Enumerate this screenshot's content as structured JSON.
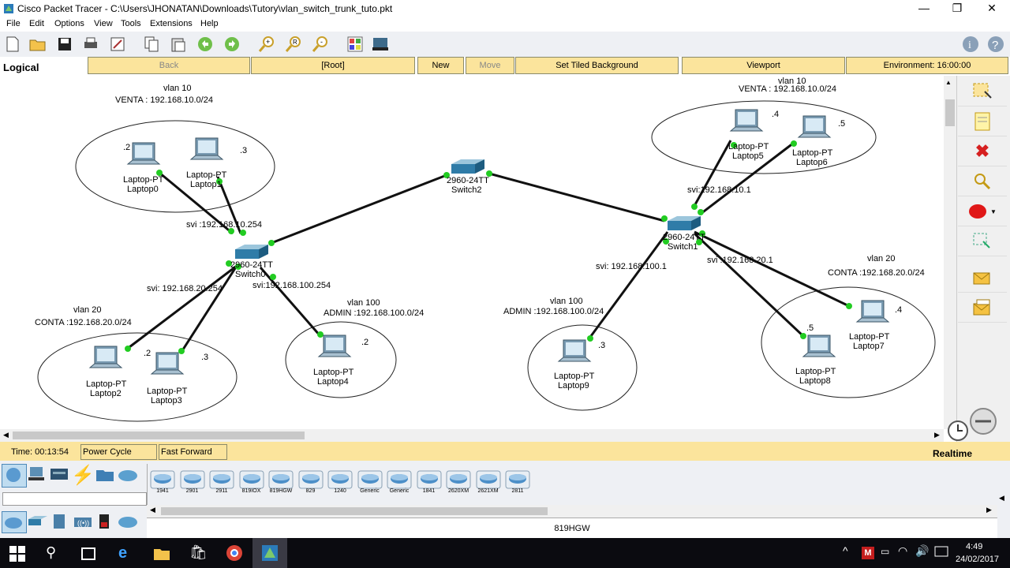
{
  "window": {
    "title": "Cisco Packet Tracer - C:\\Users\\JHONATAN\\Downloads\\Tutory\\vlan_switch_trunk_tuto.pkt"
  },
  "menu": [
    "File",
    "Edit",
    "Options",
    "View",
    "Tools",
    "Extensions",
    "Help"
  ],
  "nav": {
    "mode": "Logical",
    "back": "Back",
    "root": "[Root]",
    "new_cluster": "New Cluster",
    "move_object": "Move Object",
    "tiled_bg": "Set Tiled Background",
    "viewport": "Viewport",
    "environment": "Environment: 16:00:00"
  },
  "topology": {
    "switch0": {
      "model": "2960-24TT",
      "name": "Switch0"
    },
    "switch1": {
      "model": "2960-24TT",
      "name": "Switch1"
    },
    "switch2": {
      "model": "2960-24TT",
      "name": "Switch2"
    },
    "devices": {
      "laptop0": {
        "model": "Laptop-PT",
        "name": "Laptop0",
        "ip": ".2"
      },
      "laptop1": {
        "model": "Laptop-PT",
        "name": "Laptop1",
        "ip": ".3"
      },
      "laptop2": {
        "model": "Laptop-PT",
        "name": "Laptop2",
        "ip": ".2"
      },
      "laptop3": {
        "model": "Laptop-PT",
        "name": "Laptop3",
        "ip": ".3"
      },
      "laptop4": {
        "model": "Laptop-PT",
        "name": "Laptop4",
        "ip": ".2"
      },
      "laptop5": {
        "model": "Laptop-PT",
        "name": "Laptop5",
        "ip": ".4"
      },
      "laptop6": {
        "model": "Laptop-PT",
        "name": "Laptop6",
        "ip": ".5"
      },
      "laptop7": {
        "model": "Laptop-PT",
        "name": "Laptop7",
        "ip": ".4"
      },
      "laptop8": {
        "model": "Laptop-PT",
        "name": "Laptop8",
        "ip": ".5"
      },
      "laptop9": {
        "model": "Laptop-PT",
        "name": "Laptop9",
        "ip": ".3"
      }
    },
    "notes": {
      "l_vlan10": "vlan 10",
      "l_venta": "VENTA : 192.168.10.0/24",
      "l_vlan20": "vlan 20",
      "l_conta": "CONTA :192.168.20.0/24",
      "l_vlan100": "vlan 100",
      "l_admin": "ADMIN :192.168.100.0/24",
      "l_svi10": "svi :192.168.10.254",
      "l_svi20": "svi: 192.168.20.254",
      "l_svi100": "svi:192.168.100.254",
      "r_vlan10": "vlan 10",
      "r_venta": "VENTA : 192.168.10.0/24",
      "r_vlan20": "vlan 20",
      "r_conta": "CONTA :192.168.20.0/24",
      "r_vlan100": "vlan 100",
      "r_admin": "ADMIN :192.168.100.0/24",
      "r_svi10": "svi:192.168.10.1",
      "r_svi20": "svi :192.168.20.1",
      "r_svi100": "svi: 192.168.100.1"
    }
  },
  "timebar": {
    "time": "Time: 00:13:54",
    "power_cycle": "Power Cycle Devices",
    "fast_forward": "Fast Forward Time",
    "realtime": "Realtime"
  },
  "devices_panel": {
    "routers": [
      "1941",
      "2901",
      "2911",
      "819IOX",
      "819HGW",
      "829",
      "1240",
      "Generic",
      "Generic",
      "1841",
      "2620XM",
      "2621XM",
      "2811"
    ],
    "selected": "819HGW"
  },
  "taskbar": {
    "time": "4:49",
    "date": "24/02/2017"
  }
}
